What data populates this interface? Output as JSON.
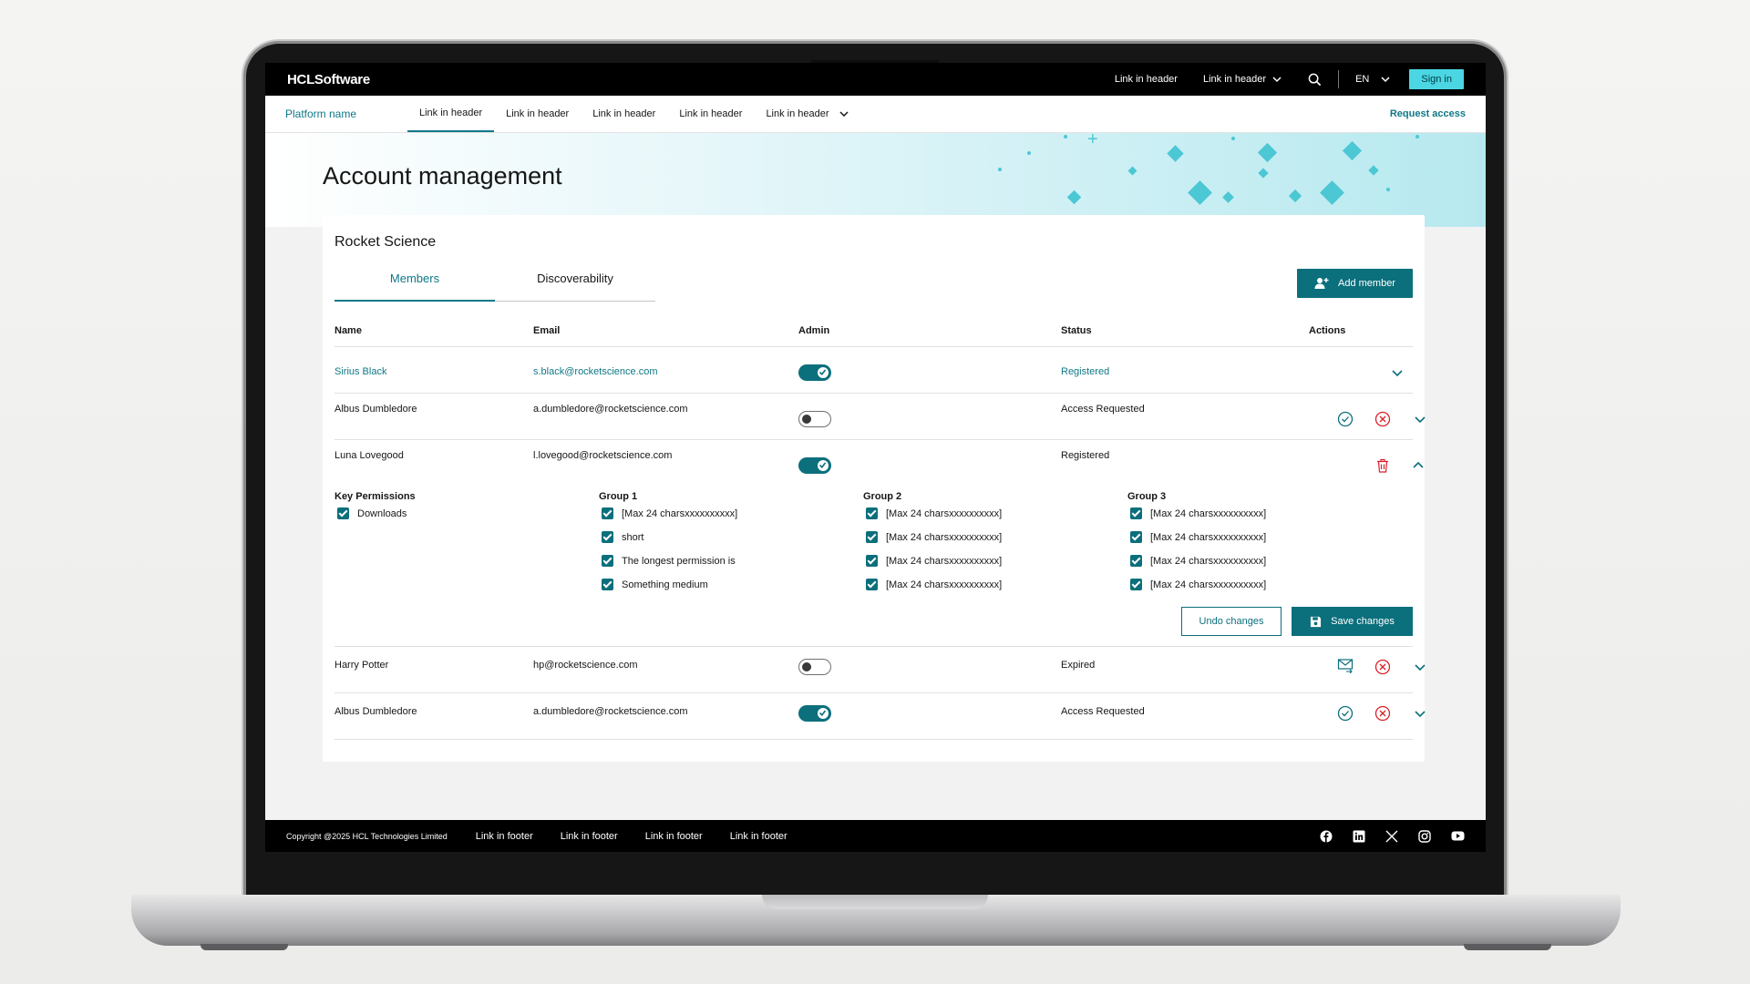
{
  "colors": {
    "accent": "#0b6f7c",
    "link": "#0f7887",
    "signin": "#4bd6e3",
    "danger": "#da1e28"
  },
  "header": {
    "brand": "HCLSoftware",
    "link1": "Link in header",
    "link2": "Link in header",
    "language": "EN",
    "signin": "Sign in"
  },
  "subnav": {
    "platform": "Platform name",
    "links": [
      "Link in header",
      "Link in header",
      "Link in header",
      "Link in header",
      "Link in header"
    ],
    "request": "Request access"
  },
  "page": {
    "title": "Account management"
  },
  "card": {
    "title": "Rocket Science",
    "tabs": [
      "Members",
      "Discoverability"
    ],
    "add_member": "Add member"
  },
  "table": {
    "headers": [
      "Name",
      "Email",
      "Admin",
      "Status",
      "Actions"
    ],
    "rows": [
      {
        "name": "Sirius Black",
        "email": "s.black@rocketscience.com",
        "admin": true,
        "status": "Registered"
      },
      {
        "name": "Albus Dumbledore",
        "email": "a.dumbledore@rocketscience.com",
        "admin": false,
        "status": "Access Requested"
      },
      {
        "name": "Luna Lovegood",
        "email": "l.lovegood@rocketscience.com",
        "admin": true,
        "status": "Registered"
      },
      {
        "name": "Harry Potter",
        "email": "hp@rocketscience.com",
        "admin": false,
        "status": "Expired"
      },
      {
        "name": "Albus Dumbledore",
        "email": "a.dumbledore@rocketscience.com",
        "admin": true,
        "status": "Access Requested"
      }
    ]
  },
  "permissions": {
    "key_title": "Key Permissions",
    "key_items": [
      "Downloads"
    ],
    "group1_title": "Group 1",
    "group1": [
      "[Max 24 charsxxxxxxxxxx]",
      "short",
      "The longest permission is",
      "Something medium"
    ],
    "group2_title": "Group 2",
    "group2": [
      "[Max 24 charsxxxxxxxxxx]",
      "[Max 24 charsxxxxxxxxxx]",
      "[Max 24 charsxxxxxxxxxx]",
      "[Max 24 charsxxxxxxxxxx]"
    ],
    "group3_title": "Group 3",
    "group3": [
      "[Max 24 charsxxxxxxxxxx]",
      "[Max 24 charsxxxxxxxxxx]",
      "[Max 24 charsxxxxxxxxxx]",
      "[Max 24 charsxxxxxxxxxx]"
    ],
    "undo": "Undo changes",
    "save": "Save changes"
  },
  "footer": {
    "copyright": "Copyright @2025 HCL Technologies Limited",
    "links": [
      "Link in footer",
      "Link in footer",
      "Link in footer",
      "Link in footer"
    ],
    "social_icons": [
      "facebook-icon",
      "linkedin-icon",
      "x-icon",
      "instagram-icon",
      "youtube-icon"
    ]
  }
}
